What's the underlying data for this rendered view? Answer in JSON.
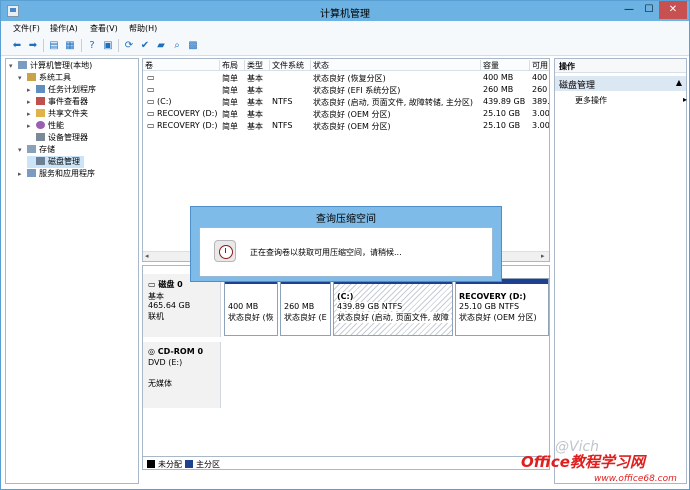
{
  "window": {
    "title": "计算机管理",
    "min": "—",
    "max": "☐",
    "close": "✕"
  },
  "menu": [
    "文件(F)",
    "操作(A)",
    "查看(V)",
    "帮助(H)"
  ],
  "tree": [
    {
      "label": "计算机管理(本地)",
      "exp": "▾"
    },
    {
      "label": "系统工具",
      "exp": "▾"
    },
    {
      "label": "任务计划程序",
      "exp": "▸"
    },
    {
      "label": "事件查看器",
      "exp": "▸"
    },
    {
      "label": "共享文件夹",
      "exp": "▸"
    },
    {
      "label": "性能",
      "exp": "▸"
    },
    {
      "label": "设备管理器",
      "exp": ""
    },
    {
      "label": "存储",
      "exp": "▾"
    },
    {
      "label": "磁盘管理",
      "exp": ""
    },
    {
      "label": "服务和应用程序",
      "exp": "▸"
    }
  ],
  "volumes": {
    "headers": [
      "卷",
      "布局",
      "类型",
      "文件系统",
      "状态",
      "容量",
      "可用"
    ],
    "rows": [
      [
        "",
        "简单",
        "基本",
        "",
        "状态良好 (恢复分区)",
        "400 MB",
        "400"
      ],
      [
        "",
        "简单",
        "基本",
        "",
        "状态良好 (EFI 系统分区)",
        "260 MB",
        "260"
      ],
      [
        "(C:)",
        "简单",
        "基本",
        "NTFS",
        "状态良好 (启动, 页面文件, 故障转储, 主分区)",
        "439.89 GB",
        "389."
      ],
      [
        "RECOVERY (D:)",
        "简单",
        "基本",
        "",
        "状态良好 (OEM 分区)",
        "25.10 GB",
        "3.00"
      ],
      [
        "RECOVERY (D:)",
        "简单",
        "基本",
        "NTFS",
        "状态良好 (OEM 分区)",
        "25.10 GB",
        "3.00"
      ]
    ]
  },
  "disks": [
    {
      "name": "磁盘 0",
      "type": "基本",
      "size": "465.64 GB",
      "status": "联机",
      "partitions": [
        {
          "title": "",
          "size": "400 MB",
          "status": "状态良好 (恢"
        },
        {
          "title": "",
          "size": "260 MB",
          "status": "状态良好 (E"
        },
        {
          "title": "(C:)",
          "size": "439.89 GB NTFS",
          "status": "状态良好 (启动, 页面文件, 故障"
        },
        {
          "title": "RECOVERY  (D:)",
          "size": "25.10 GB NTFS",
          "status": "状态良好 (OEM 分区)"
        }
      ]
    },
    {
      "name": "CD-ROM 0",
      "type": "DVD (E:)",
      "size": "",
      "status": "无媒体"
    }
  ],
  "legend": [
    {
      "label": "未分配",
      "color": "#000000"
    },
    {
      "label": "主分区",
      "color": "#1f3f8f"
    }
  ],
  "actions": {
    "header": "操作",
    "section": "磁盘管理",
    "more": "更多操作",
    "arrow_up": "▲",
    "arrow_right": "▸"
  },
  "dialog": {
    "title": "查询压缩空间",
    "message": "正在查询卷以获取可用压缩空间，请稍候..."
  },
  "watermark": {
    "mark": "@Vich",
    "brand": "Office教程学习网",
    "url": "www.office68.com"
  }
}
